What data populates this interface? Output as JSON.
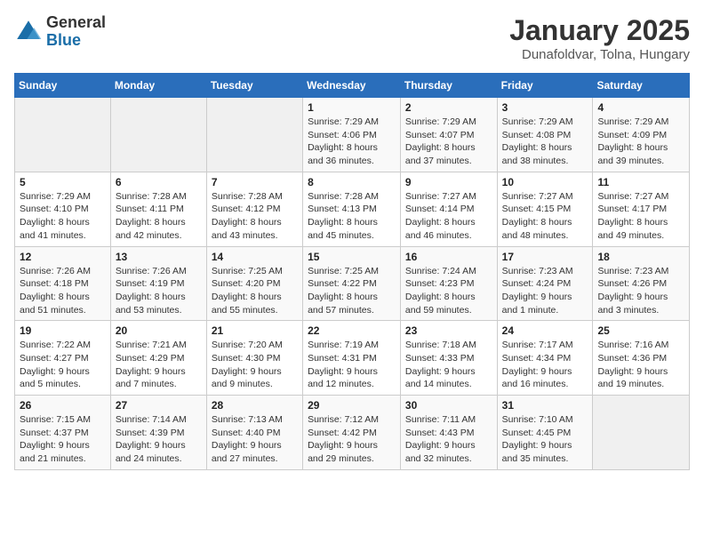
{
  "logo": {
    "general": "General",
    "blue": "Blue"
  },
  "title": "January 2025",
  "location": "Dunafoldvar, Tolna, Hungary",
  "headers": [
    "Sunday",
    "Monday",
    "Tuesday",
    "Wednesday",
    "Thursday",
    "Friday",
    "Saturday"
  ],
  "weeks": [
    [
      {
        "day": "",
        "info": ""
      },
      {
        "day": "",
        "info": ""
      },
      {
        "day": "",
        "info": ""
      },
      {
        "day": "1",
        "info": "Sunrise: 7:29 AM\nSunset: 4:06 PM\nDaylight: 8 hours and 36 minutes."
      },
      {
        "day": "2",
        "info": "Sunrise: 7:29 AM\nSunset: 4:07 PM\nDaylight: 8 hours and 37 minutes."
      },
      {
        "day": "3",
        "info": "Sunrise: 7:29 AM\nSunset: 4:08 PM\nDaylight: 8 hours and 38 minutes."
      },
      {
        "day": "4",
        "info": "Sunrise: 7:29 AM\nSunset: 4:09 PM\nDaylight: 8 hours and 39 minutes."
      }
    ],
    [
      {
        "day": "5",
        "info": "Sunrise: 7:29 AM\nSunset: 4:10 PM\nDaylight: 8 hours and 41 minutes."
      },
      {
        "day": "6",
        "info": "Sunrise: 7:28 AM\nSunset: 4:11 PM\nDaylight: 8 hours and 42 minutes."
      },
      {
        "day": "7",
        "info": "Sunrise: 7:28 AM\nSunset: 4:12 PM\nDaylight: 8 hours and 43 minutes."
      },
      {
        "day": "8",
        "info": "Sunrise: 7:28 AM\nSunset: 4:13 PM\nDaylight: 8 hours and 45 minutes."
      },
      {
        "day": "9",
        "info": "Sunrise: 7:27 AM\nSunset: 4:14 PM\nDaylight: 8 hours and 46 minutes."
      },
      {
        "day": "10",
        "info": "Sunrise: 7:27 AM\nSunset: 4:15 PM\nDaylight: 8 hours and 48 minutes."
      },
      {
        "day": "11",
        "info": "Sunrise: 7:27 AM\nSunset: 4:17 PM\nDaylight: 8 hours and 49 minutes."
      }
    ],
    [
      {
        "day": "12",
        "info": "Sunrise: 7:26 AM\nSunset: 4:18 PM\nDaylight: 8 hours and 51 minutes."
      },
      {
        "day": "13",
        "info": "Sunrise: 7:26 AM\nSunset: 4:19 PM\nDaylight: 8 hours and 53 minutes."
      },
      {
        "day": "14",
        "info": "Sunrise: 7:25 AM\nSunset: 4:20 PM\nDaylight: 8 hours and 55 minutes."
      },
      {
        "day": "15",
        "info": "Sunrise: 7:25 AM\nSunset: 4:22 PM\nDaylight: 8 hours and 57 minutes."
      },
      {
        "day": "16",
        "info": "Sunrise: 7:24 AM\nSunset: 4:23 PM\nDaylight: 8 hours and 59 minutes."
      },
      {
        "day": "17",
        "info": "Sunrise: 7:23 AM\nSunset: 4:24 PM\nDaylight: 9 hours and 1 minute."
      },
      {
        "day": "18",
        "info": "Sunrise: 7:23 AM\nSunset: 4:26 PM\nDaylight: 9 hours and 3 minutes."
      }
    ],
    [
      {
        "day": "19",
        "info": "Sunrise: 7:22 AM\nSunset: 4:27 PM\nDaylight: 9 hours and 5 minutes."
      },
      {
        "day": "20",
        "info": "Sunrise: 7:21 AM\nSunset: 4:29 PM\nDaylight: 9 hours and 7 minutes."
      },
      {
        "day": "21",
        "info": "Sunrise: 7:20 AM\nSunset: 4:30 PM\nDaylight: 9 hours and 9 minutes."
      },
      {
        "day": "22",
        "info": "Sunrise: 7:19 AM\nSunset: 4:31 PM\nDaylight: 9 hours and 12 minutes."
      },
      {
        "day": "23",
        "info": "Sunrise: 7:18 AM\nSunset: 4:33 PM\nDaylight: 9 hours and 14 minutes."
      },
      {
        "day": "24",
        "info": "Sunrise: 7:17 AM\nSunset: 4:34 PM\nDaylight: 9 hours and 16 minutes."
      },
      {
        "day": "25",
        "info": "Sunrise: 7:16 AM\nSunset: 4:36 PM\nDaylight: 9 hours and 19 minutes."
      }
    ],
    [
      {
        "day": "26",
        "info": "Sunrise: 7:15 AM\nSunset: 4:37 PM\nDaylight: 9 hours and 21 minutes."
      },
      {
        "day": "27",
        "info": "Sunrise: 7:14 AM\nSunset: 4:39 PM\nDaylight: 9 hours and 24 minutes."
      },
      {
        "day": "28",
        "info": "Sunrise: 7:13 AM\nSunset: 4:40 PM\nDaylight: 9 hours and 27 minutes."
      },
      {
        "day": "29",
        "info": "Sunrise: 7:12 AM\nSunset: 4:42 PM\nDaylight: 9 hours and 29 minutes."
      },
      {
        "day": "30",
        "info": "Sunrise: 7:11 AM\nSunset: 4:43 PM\nDaylight: 9 hours and 32 minutes."
      },
      {
        "day": "31",
        "info": "Sunrise: 7:10 AM\nSunset: 4:45 PM\nDaylight: 9 hours and 35 minutes."
      },
      {
        "day": "",
        "info": ""
      }
    ]
  ]
}
